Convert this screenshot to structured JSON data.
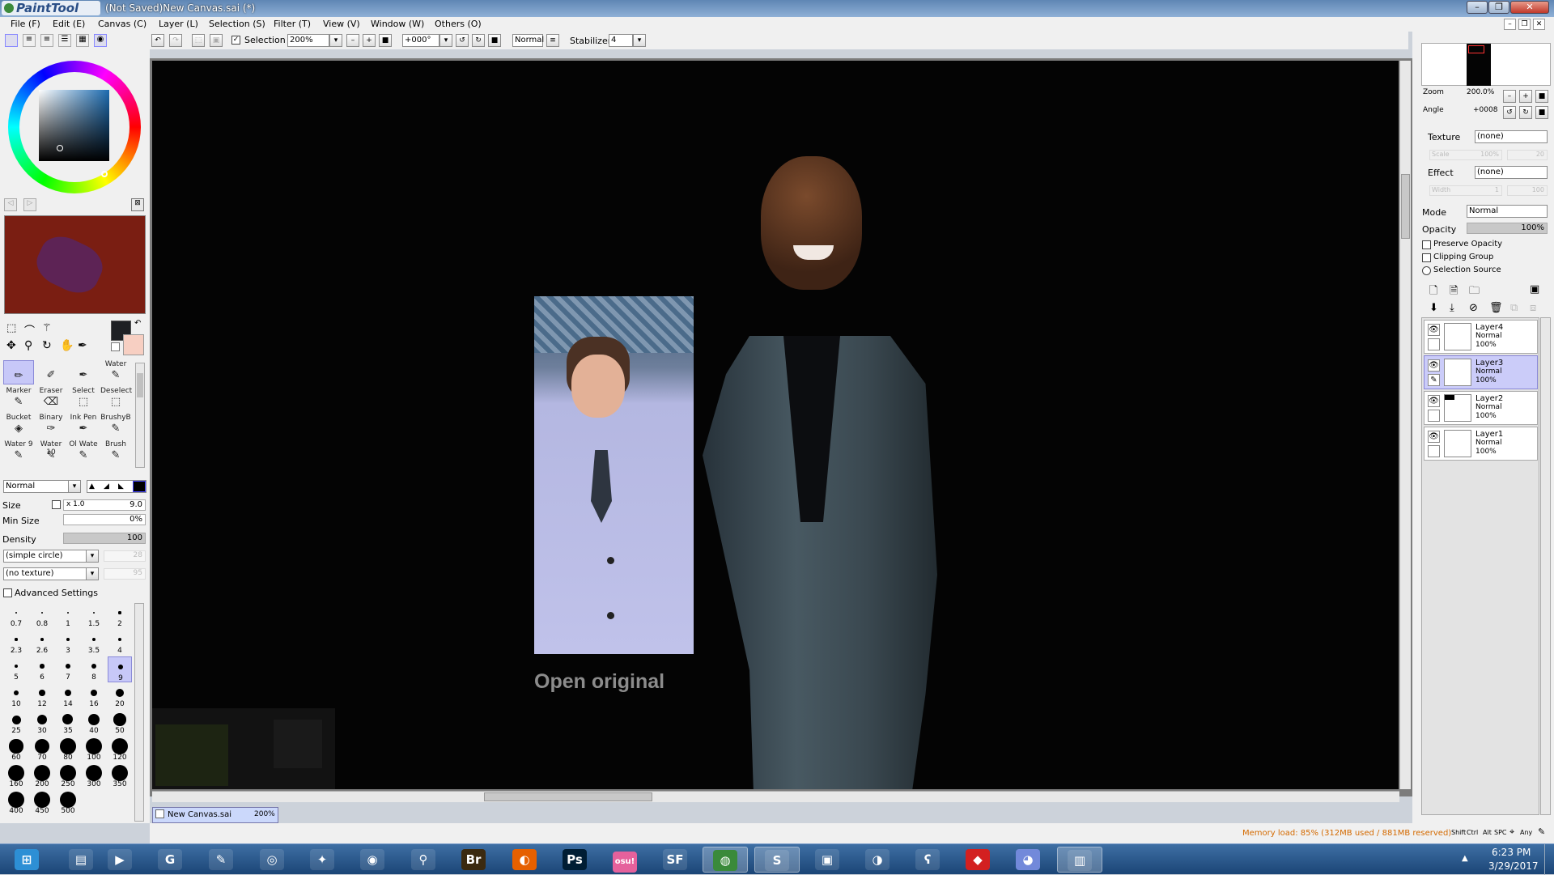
{
  "window": {
    "app_logo": "PaintTool SAI",
    "title": "(Not Saved)New Canvas.sai (*)",
    "buttons": {
      "minimize": "–",
      "restore": "❐",
      "close": "✕"
    }
  },
  "menu": {
    "items": [
      "File (F)",
      "Edit (E)",
      "Canvas (C)",
      "Layer (L)",
      "Selection (S)",
      "Filter (T)",
      "View (V)",
      "Window (W)",
      "Others (O)"
    ]
  },
  "toolbar": {
    "selection_label": "Selection",
    "zoom_value": "200%",
    "angle_value": "+000°",
    "blend_mode": "Normal",
    "stabilizer_label": "Stabilizer",
    "stabilizer_value": "4"
  },
  "brush": {
    "mode": "Normal",
    "size_label": "Size",
    "size_multiplier": "x 1.0",
    "size_value": "9.0",
    "min_size_label": "Min Size",
    "min_size_value": "0%",
    "density_label": "Density",
    "density_value": "100",
    "shape": "(simple circle)",
    "shape_strength": "28",
    "texture": "(no texture)",
    "texture_strength": "95",
    "advanced_label": "Advanced Settings"
  },
  "tools": [
    {
      "label": "",
      "icon": "pencil"
    },
    {
      "label": "",
      "icon": "airbrush"
    },
    {
      "label": "",
      "icon": "pen"
    },
    {
      "label": "Water",
      "icon": "water-brush"
    },
    {
      "label": "Marker",
      "icon": "marker"
    },
    {
      "label": "Eraser",
      "icon": "eraser"
    },
    {
      "label": "Select",
      "icon": "select-brush"
    },
    {
      "label": "Deselect",
      "icon": "deselect-brush"
    },
    {
      "label": "Bucket",
      "icon": "bucket"
    },
    {
      "label": "Binary",
      "icon": "binary-pen"
    },
    {
      "label": "Ink Pen",
      "icon": "ink-pen"
    },
    {
      "label": "BrushyB",
      "icon": "brush"
    },
    {
      "label": "Water 9",
      "icon": "water-brush"
    },
    {
      "label": "Water 10",
      "icon": "water-brush"
    },
    {
      "label": "Ol Wate",
      "icon": "oil-water"
    },
    {
      "label": "Brush",
      "icon": "brush"
    }
  ],
  "brush_sizes": [
    "0.7",
    "0.8",
    "1",
    "1.5",
    "2",
    "2.3",
    "2.6",
    "3",
    "3.5",
    "4",
    "5",
    "6",
    "7",
    "8",
    "9",
    "10",
    "12",
    "14",
    "16",
    "20",
    "25",
    "30",
    "35",
    "40",
    "50",
    "60",
    "70",
    "80",
    "100",
    "120",
    "160",
    "200",
    "250",
    "300",
    "350",
    "400",
    "450",
    "500"
  ],
  "canvas": {
    "overlay_text": "Open original",
    "document_tab": "New Canvas.sai",
    "document_zoom": "200%"
  },
  "navigator": {
    "zoom_label": "Zoom",
    "zoom_value": "200.0%",
    "angle_label": "Angle",
    "angle_value": "+0008"
  },
  "layer_props": {
    "texture_label": "Texture",
    "texture_value": "(none)",
    "scale_label": "Scale",
    "scale_value": "100%",
    "scale_strength": "20",
    "effect_label": "Effect",
    "effect_value": "(none)",
    "width_label": "Width",
    "width_value": "1",
    "width_strength": "100",
    "mode_label": "Mode",
    "mode_value": "Normal",
    "opacity_label": "Opacity",
    "opacity_value": "100%",
    "preserve_opacity": "Preserve Opacity",
    "clipping_group": "Clipping Group",
    "selection_source": "Selection Source"
  },
  "layers": [
    {
      "name": "Layer4",
      "mode": "Normal",
      "opacity": "100%",
      "selected": false
    },
    {
      "name": "Layer3",
      "mode": "Normal",
      "opacity": "100%",
      "selected": true
    },
    {
      "name": "Layer2",
      "mode": "Normal",
      "opacity": "100%",
      "selected": false
    },
    {
      "name": "Layer1",
      "mode": "Normal",
      "opacity": "100%",
      "selected": false
    }
  ],
  "status": {
    "memory": "Memory load: 85% (312MB used / 881MB reserved)",
    "keys": [
      "Shift",
      "Ctrl",
      "Alt",
      "SPC",
      "Any"
    ]
  },
  "taskbar": {
    "apps": [
      {
        "name": "start",
        "glyph": "⊞"
      },
      {
        "name": "explorer",
        "glyph": "▤"
      },
      {
        "name": "media-player",
        "glyph": "▶"
      },
      {
        "name": "steam-like",
        "glyph": "G"
      },
      {
        "name": "pencil-app",
        "glyph": "✎"
      },
      {
        "name": "overwatch",
        "glyph": "◎"
      },
      {
        "name": "game",
        "glyph": "✦"
      },
      {
        "name": "obs",
        "glyph": "◉"
      },
      {
        "name": "counter-strike",
        "glyph": "⚲"
      },
      {
        "name": "bridge",
        "glyph": "Br"
      },
      {
        "name": "firefox",
        "glyph": "◐"
      },
      {
        "name": "photoshop",
        "glyph": "Ps"
      },
      {
        "name": "osu",
        "glyph": "osu!"
      },
      {
        "name": "sf",
        "glyph": "SF"
      },
      {
        "name": "chrome",
        "glyph": "◍"
      },
      {
        "name": "sai",
        "glyph": "S"
      },
      {
        "name": "app-7",
        "glyph": "▣"
      },
      {
        "name": "paint",
        "glyph": "◑"
      },
      {
        "name": "bear-app",
        "glyph": "ʕ"
      },
      {
        "name": "roblox",
        "glyph": "◆"
      },
      {
        "name": "discord",
        "glyph": "◕"
      },
      {
        "name": "folder-app",
        "glyph": "▥"
      }
    ],
    "time": "6:23 PM",
    "date": "3/29/2017"
  },
  "colors": {
    "primary": "#1e2024",
    "secondary": "#f7cfc2",
    "selection": "#c7c8f8"
  }
}
